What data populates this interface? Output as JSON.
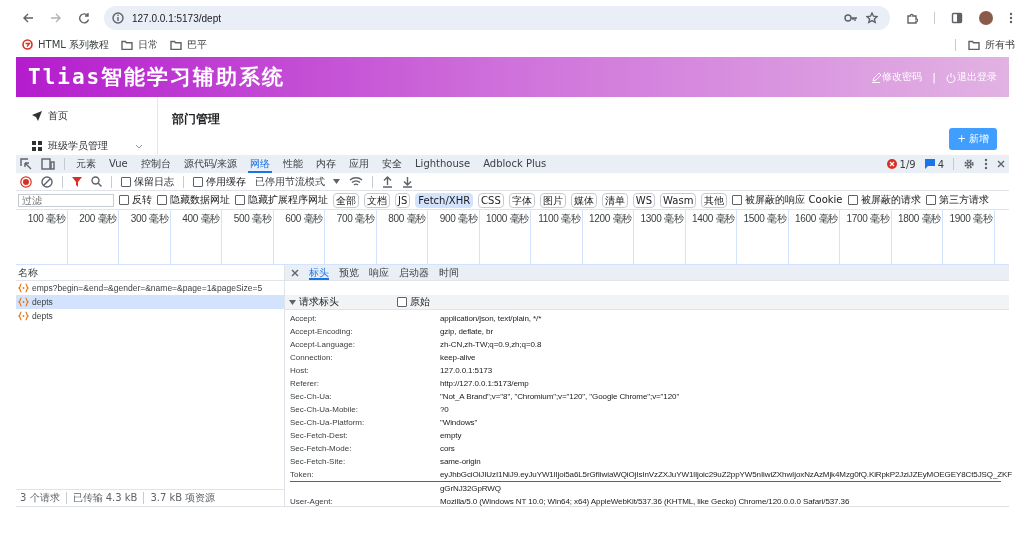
{
  "browser": {
    "url": "127.0.0.1:5173/dept",
    "bookmarks": [
      {
        "kind": "site",
        "label": "HTML 系列教程"
      },
      {
        "kind": "folder",
        "label": "日常"
      },
      {
        "kind": "folder",
        "label": "巴平"
      }
    ],
    "all_bookmarks": {
      "kind": "folder",
      "label": "所有书"
    }
  },
  "app": {
    "title": "Tlias智能学习辅助系统",
    "header_links": [
      {
        "kind": "edit",
        "label": "修改密码"
      },
      {
        "kind": "power",
        "label": "退出登录"
      }
    ],
    "separator": "|",
    "sidebar": {
      "items": [
        {
          "kind": "send",
          "label": "首页",
          "expandable": false
        },
        {
          "kind": "grid",
          "label": "班级学员管理",
          "expandable": true
        }
      ]
    },
    "page_title": "部门管理",
    "add_button": "+ 新增"
  },
  "devtools": {
    "tabs": [
      {
        "label": "元素",
        "selected": false
      },
      {
        "label": "Vue",
        "selected": false
      },
      {
        "label": "控制台",
        "selected": false
      },
      {
        "label": "源代码/来源",
        "selected": false
      },
      {
        "label": "网络",
        "selected": true
      },
      {
        "label": "性能",
        "selected": false
      },
      {
        "label": "内存",
        "selected": false
      },
      {
        "label": "应用",
        "selected": false
      },
      {
        "label": "安全",
        "selected": false
      },
      {
        "label": "Lighthouse",
        "selected": false
      },
      {
        "label": "Adblock Plus",
        "selected": false
      }
    ],
    "errors": "1/9",
    "messages": "4",
    "toolbar": {
      "options": [
        {
          "label": "保留日志",
          "checked": false
        },
        {
          "label": "停用缓存",
          "checked": false
        }
      ],
      "throttling": "已停用节流模式"
    },
    "filter": {
      "placeholder": "过滤",
      "options": [
        {
          "label": "反转",
          "checked": false
        },
        {
          "label": "隐藏数据网址",
          "checked": false
        },
        {
          "label": "隐藏扩展程序网址",
          "checked": false
        }
      ],
      "types": [
        {
          "label": "全部",
          "selected": false
        },
        {
          "label": "文档",
          "selected": false
        },
        {
          "label": "JS",
          "selected": false
        },
        {
          "label": "Fetch/XHR",
          "selected": true
        },
        {
          "label": "CSS",
          "selected": false
        },
        {
          "label": "字体",
          "selected": false
        },
        {
          "label": "图片",
          "selected": false
        },
        {
          "label": "媒体",
          "selected": false
        },
        {
          "label": "清单",
          "selected": false
        },
        {
          "label": "WS",
          "selected": false
        },
        {
          "label": "Wasm",
          "selected": false
        },
        {
          "label": "其他",
          "selected": false
        }
      ],
      "more_options": [
        {
          "label": "被屏蔽的响应 Cookie",
          "checked": false
        },
        {
          "label": "被屏蔽的请求",
          "checked": false
        },
        {
          "label": "第三方请求",
          "checked": false
        }
      ]
    },
    "timeline": {
      "ticks": [
        "100 毫秒",
        "200 毫秒",
        "300 毫秒",
        "400 毫秒",
        "500 毫秒",
        "600 毫秒",
        "700 毫秒",
        "800 毫秒",
        "900 毫秒",
        "1000 毫秒",
        "1100 毫秒",
        "1200 毫秒",
        "1300 毫秒",
        "1400 毫秒",
        "1500 毫秒",
        "1600 毫秒",
        "1700 毫秒",
        "1800 毫秒",
        "1900 毫秒"
      ]
    },
    "requests": {
      "header": "名称",
      "rows": [
        {
          "name": "emps?begin=&end=&gender=&name=&page=1&pageSize=5",
          "selected": false
        },
        {
          "name": "depts",
          "selected": true
        },
        {
          "name": "depts",
          "selected": false
        }
      ]
    },
    "status": [
      "3 个请求",
      "已传输 4.3 kB",
      "3.7 kB 项资源"
    ],
    "detail": {
      "tabs": [
        {
          "label": "标头",
          "selected": true
        },
        {
          "label": "预览",
          "selected": false
        },
        {
          "label": "响应",
          "selected": false
        },
        {
          "label": "启动器",
          "selected": false
        },
        {
          "label": "时间",
          "selected": false
        }
      ],
      "section": {
        "title": "请求标头",
        "expanded": true,
        "raw": {
          "label": "原始",
          "checked": false
        }
      },
      "headers": [
        {
          "name": "Accept:",
          "value": "application/json, text/plain, */*",
          "marked": false
        },
        {
          "name": "Accept-Encoding:",
          "value": "gzip, deflate, br",
          "marked": false
        },
        {
          "name": "Accept-Language:",
          "value": "zh-CN,zh-TW;q=0.9,zh;q=0.8",
          "marked": false
        },
        {
          "name": "Connection:",
          "value": "keep-alive",
          "marked": false
        },
        {
          "name": "Host:",
          "value": "127.0.0.1:5173",
          "marked": false
        },
        {
          "name": "Referer:",
          "value": "http://127.0.0.1:5173/emp",
          "marked": false
        },
        {
          "name": "Sec-Ch-Ua:",
          "value": "\"Not_A Brand\";v=\"8\", \"Chromium\";v=\"120\", \"Google Chrome\";v=\"120\"",
          "marked": false
        },
        {
          "name": "Sec-Ch-Ua-Mobile:",
          "value": "?0",
          "marked": false
        },
        {
          "name": "Sec-Ch-Ua-Platform:",
          "value": "\"Windows\"",
          "marked": false
        },
        {
          "name": "Sec-Fetch-Dest:",
          "value": "empty",
          "marked": false
        },
        {
          "name": "Sec-Fetch-Mode:",
          "value": "cors",
          "marked": false
        },
        {
          "name": "Sec-Fetch-Site:",
          "value": "same-origin",
          "marked": false
        },
        {
          "name": "Token:",
          "value": "eyJhbGciOiJIUzI1NiJ9.eyJuYW1lIjoi5a6L5rGfIiwiaWQiOjIsInVzZXJuYW1lIjoic29uZ2ppYW5nIiwiZXhwIjoxNzAzMjk4Mzg0fQ.KiRpkP2JziJZEyMOEGEY8Ct5JSQ_ZKF",
          "value_continued": "gGrNJ32GpRWQ",
          "marked": true
        },
        {
          "name": "User-Agent:",
          "value": "Mozilla/5.0 (Windows NT 10.0; Win64; x64) AppleWebKit/537.36 (KHTML, like Gecko) Chrome/120.0.0.0 Safari/537.36",
          "marked": false
        }
      ]
    }
  }
}
